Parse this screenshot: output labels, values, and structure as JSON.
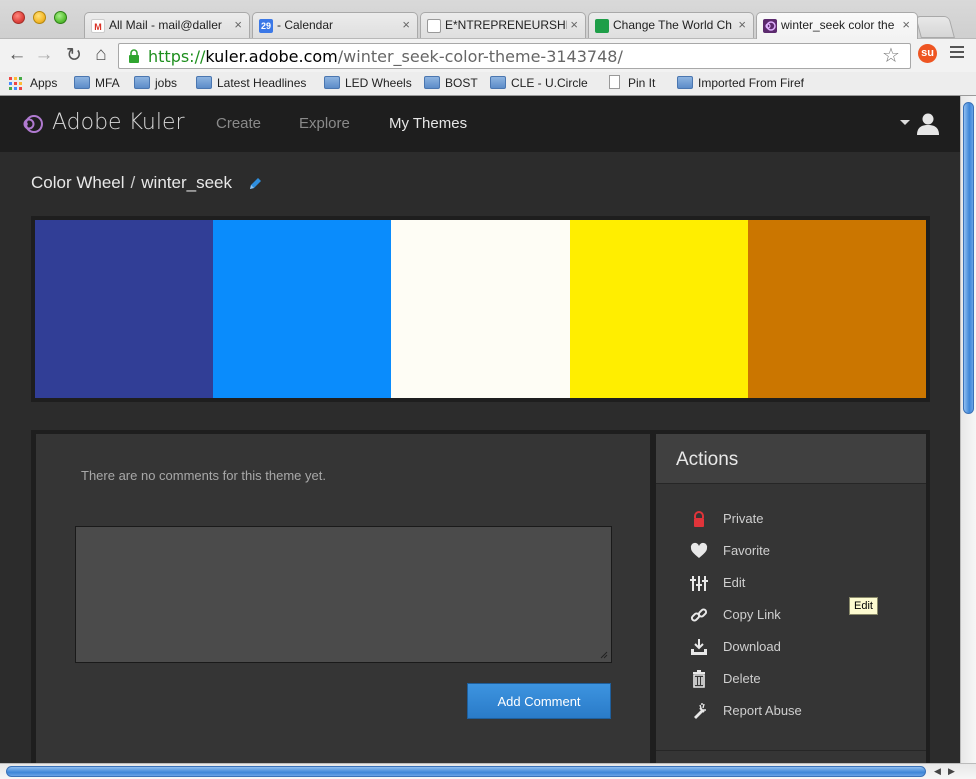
{
  "browser": {
    "tabs": [
      {
        "label": "All Mail - mail@daller",
        "icon": "gmail-icon",
        "icon_text": "M",
        "icon_color": "#d93025",
        "active": false
      },
      {
        "label": "- Calendar",
        "icon": "calendar-icon",
        "icon_text": "29",
        "icon_color": "#3b78e7",
        "active": false
      },
      {
        "label": "E*NTREPRENEURSHIP",
        "icon": "page-icon",
        "icon_text": "",
        "icon_color": "#ffffff",
        "active": false
      },
      {
        "label": "Change The World Ch",
        "icon": "sheet-icon",
        "icon_text": "",
        "icon_color": "#1e9e48",
        "active": false
      },
      {
        "label": "winter_seek color the",
        "icon": "kuler-icon",
        "icon_text": "",
        "icon_color": "#5c2a6e",
        "active": true
      }
    ],
    "url": {
      "scheme": "https://",
      "host": "kuler.adobe.com",
      "path": "/winter_seek-color-theme-3143748/"
    },
    "bookmarks": [
      {
        "label": "Apps",
        "type": "apps"
      },
      {
        "label": "MFA",
        "type": "folder"
      },
      {
        "label": "jobs",
        "type": "folder"
      },
      {
        "label": "Latest Headlines",
        "type": "folder"
      },
      {
        "label": "LED Wheels",
        "type": "folder"
      },
      {
        "label": "BOST",
        "type": "folder"
      },
      {
        "label": "CLE - U.Circle",
        "type": "folder"
      },
      {
        "label": "Pin It",
        "type": "page"
      },
      {
        "label": "Imported From Firef",
        "type": "folder"
      }
    ]
  },
  "header": {
    "brand": "Adobe Kuler",
    "nav": [
      {
        "label": "Create",
        "active": false
      },
      {
        "label": "Explore",
        "active": false
      },
      {
        "label": "My Themes",
        "active": true
      }
    ]
  },
  "breadcrumb": {
    "parent": "Color Wheel",
    "separator": "/",
    "current": "winter_seek"
  },
  "theme": {
    "swatches": [
      "#313E96",
      "#0A8CFC",
      "#FEFDF5",
      "#FFEE00",
      "#CB7600"
    ]
  },
  "comments": {
    "empty_text": "There are no comments for this theme yet.",
    "textarea_value": "",
    "add_label": "Add Comment"
  },
  "actions": {
    "title": "Actions",
    "items": [
      {
        "label": "Private",
        "icon": "lock-icon",
        "color": "#e0343a"
      },
      {
        "label": "Favorite",
        "icon": "heart-icon",
        "color": "#e8e8e8"
      },
      {
        "label": "Edit",
        "icon": "sliders-icon",
        "color": "#e8e8e8"
      },
      {
        "label": "Copy Link",
        "icon": "link-icon",
        "color": "#e8e8e8"
      },
      {
        "label": "Download",
        "icon": "download-icon",
        "color": "#e8e8e8"
      },
      {
        "label": "Delete",
        "icon": "trash-icon",
        "color": "#e8e8e8"
      },
      {
        "label": "Report Abuse",
        "icon": "report-icon",
        "color": "#e8e8e8"
      }
    ]
  },
  "tooltip": {
    "text": "Edit"
  },
  "colors": {
    "accent": "#2a7bc8"
  }
}
